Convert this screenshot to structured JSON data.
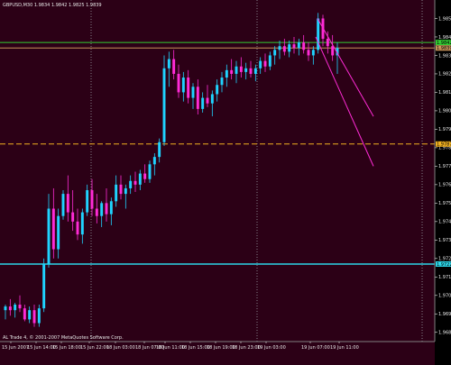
{
  "chart_header": "GBPUSD,M30  1.9834 1.9842 1.9825 1.9839",
  "copyright": "AL Trade 4, © 2001-2007 MetaQuotes Software Corp.",
  "colors": {
    "background": "#2c0016",
    "axis_panel": "#000000",
    "bull_candle": "#1fd3ff",
    "bear_candle": "#ff2bd6",
    "green_line": "#33cc33",
    "tan_line": "#c8935a",
    "orange_dash": "#f0b020",
    "cyan_line": "#2dd6e8",
    "channel": "#ff2bd6",
    "axis_text": "#e8e8e8",
    "grid_dots": "#9aa0a6"
  },
  "price_labels": {
    "green_level": "1.9842",
    "tan_level": "1.9839",
    "orange_level": "1.9787",
    "cyan_level": "1.9722"
  },
  "chart_data": {
    "type": "candlestick",
    "symbol": "GBPUSD",
    "timeframe": "M30",
    "ylim": [
      1.968,
      1.9865
    ],
    "y_ticks": [
      "1.9855",
      "1.9845",
      "1.9835",
      "1.9825",
      "1.9815",
      "1.9805",
      "1.9795",
      "1.9785",
      "1.9775",
      "1.9765",
      "1.9755",
      "1.9745",
      "1.9735",
      "1.9725",
      "1.9715",
      "1.9705",
      "1.9695",
      "1.9685"
    ],
    "x_labels": [
      "15 Jun 2007",
      "15 Jun 14:00",
      "15 Jun 18:00",
      "15 Jun 22:00",
      "18 Jun 03:00",
      "18 Jun 07:00",
      "18 Jun 11:00",
      "18 Jun 15:00",
      "18 Jun 19:00",
      "18 Jun 23:00",
      "19 Jun 03:00",
      "19 Jun 07:00",
      "19 Jun 11:00"
    ],
    "horizontal_levels": [
      1.9842,
      1.9839,
      1.9787,
      1.9722
    ],
    "candles": [
      [
        1.9697,
        1.97,
        1.9692,
        1.9699
      ],
      [
        1.9699,
        1.9703,
        1.9694,
        1.9697
      ],
      [
        1.9697,
        1.9701,
        1.9693,
        1.97
      ],
      [
        1.97,
        1.9705,
        1.9696,
        1.9698
      ],
      [
        1.9698,
        1.97,
        1.9691,
        1.9692
      ],
      [
        1.9692,
        1.9699,
        1.969,
        1.9697
      ],
      [
        1.9697,
        1.97,
        1.9688,
        1.969
      ],
      [
        1.969,
        1.97,
        1.9688,
        1.9698
      ],
      [
        1.9698,
        1.9725,
        1.9696,
        1.9722
      ],
      [
        1.9722,
        1.976,
        1.972,
        1.9752
      ],
      [
        1.9752,
        1.9763,
        1.9725,
        1.973
      ],
      [
        1.973,
        1.9752,
        1.9725,
        1.9748
      ],
      [
        1.9748,
        1.9762,
        1.9746,
        1.976
      ],
      [
        1.976,
        1.977,
        1.9745,
        1.975
      ],
      [
        1.975,
        1.9762,
        1.974,
        1.9745
      ],
      [
        1.9745,
        1.9752,
        1.9735,
        1.9738
      ],
      [
        1.9738,
        1.9752,
        1.9733,
        1.975
      ],
      [
        1.975,
        1.9765,
        1.9748,
        1.9762
      ],
      [
        1.9762,
        1.9768,
        1.9748,
        1.9752
      ],
      [
        1.9752,
        1.976,
        1.9744,
        1.9748
      ],
      [
        1.9748,
        1.9756,
        1.9742,
        1.9755
      ],
      [
        1.9755,
        1.9763,
        1.9745,
        1.9749
      ],
      [
        1.9749,
        1.9758,
        1.9743,
        1.9756
      ],
      [
        1.9756,
        1.977,
        1.9753,
        1.9765
      ],
      [
        1.9765,
        1.977,
        1.9757,
        1.976
      ],
      [
        1.976,
        1.9765,
        1.9752,
        1.9763
      ],
      [
        1.9763,
        1.977,
        1.976,
        1.9767
      ],
      [
        1.9767,
        1.9772,
        1.9761,
        1.9765
      ],
      [
        1.9765,
        1.9773,
        1.9762,
        1.9771
      ],
      [
        1.9771,
        1.9776,
        1.9766,
        1.9768
      ],
      [
        1.9768,
        1.9778,
        1.9766,
        1.9776
      ],
      [
        1.9776,
        1.9782,
        1.977,
        1.978
      ],
      [
        1.978,
        1.979,
        1.9777,
        1.9788
      ],
      [
        1.9788,
        1.9835,
        1.9786,
        1.9828
      ],
      [
        1.9828,
        1.9837,
        1.9818,
        1.9833
      ],
      [
        1.9833,
        1.9838,
        1.9822,
        1.9825
      ],
      [
        1.9825,
        1.983,
        1.9812,
        1.9815
      ],
      [
        1.9815,
        1.9826,
        1.981,
        1.9823
      ],
      [
        1.9823,
        1.9827,
        1.9809,
        1.9812
      ],
      [
        1.9812,
        1.982,
        1.9806,
        1.9818
      ],
      [
        1.9818,
        1.9822,
        1.9803,
        1.9806
      ],
      [
        1.9806,
        1.9815,
        1.9804,
        1.9812
      ],
      [
        1.9812,
        1.9819,
        1.9807,
        1.9809
      ],
      [
        1.9809,
        1.9816,
        1.9802,
        1.9814
      ],
      [
        1.9814,
        1.9822,
        1.981,
        1.9819
      ],
      [
        1.9819,
        1.9826,
        1.9815,
        1.9823
      ],
      [
        1.9823,
        1.983,
        1.9818,
        1.9827
      ],
      [
        1.9827,
        1.9833,
        1.9822,
        1.9825
      ],
      [
        1.9825,
        1.9832,
        1.982,
        1.9829
      ],
      [
        1.9829,
        1.9834,
        1.9823,
        1.9826
      ],
      [
        1.9826,
        1.9831,
        1.9822,
        1.9828
      ],
      [
        1.9828,
        1.9832,
        1.9823,
        1.9825
      ],
      [
        1.9825,
        1.983,
        1.9821,
        1.9828
      ],
      [
        1.9828,
        1.9834,
        1.9825,
        1.9832
      ],
      [
        1.9832,
        1.9836,
        1.9826,
        1.9829
      ],
      [
        1.9829,
        1.9837,
        1.9827,
        1.9835
      ],
      [
        1.9835,
        1.984,
        1.983,
        1.9838
      ],
      [
        1.9838,
        1.9843,
        1.9833,
        1.984
      ],
      [
        1.984,
        1.9844,
        1.9835,
        1.9837
      ],
      [
        1.9837,
        1.9843,
        1.9834,
        1.9841
      ],
      [
        1.9841,
        1.9845,
        1.9836,
        1.9839
      ],
      [
        1.9839,
        1.9844,
        1.9835,
        1.9842
      ],
      [
        1.9842,
        1.9846,
        1.9836,
        1.9838
      ],
      [
        1.9838,
        1.9842,
        1.9832,
        1.9835
      ],
      [
        1.9835,
        1.984,
        1.983,
        1.9838
      ],
      [
        1.9838,
        1.9858,
        1.9836,
        1.9855
      ],
      [
        1.9855,
        1.9857,
        1.984,
        1.9844
      ],
      [
        1.9844,
        1.9848,
        1.9836,
        1.984
      ],
      [
        1.984,
        1.9846,
        1.9832,
        1.9835
      ],
      [
        1.9835,
        1.9842,
        1.9825,
        1.9839
      ]
    ],
    "channel_lines": [
      [
        [
          1.9855,
          0
        ],
        [
          1.9802,
          1
        ]
      ],
      [
        [
          1.9845,
          0
        ],
        [
          1.9775,
          1
        ]
      ]
    ]
  }
}
